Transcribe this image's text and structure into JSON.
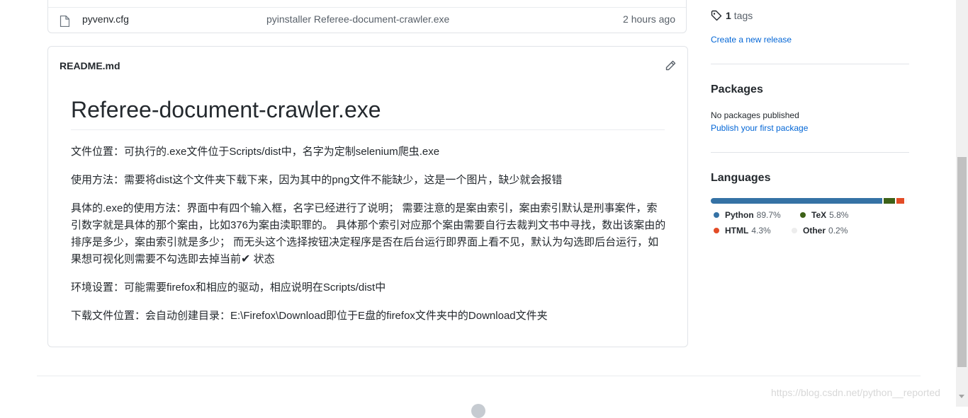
{
  "file_list": {
    "row": {
      "name": "pyvenv.cfg",
      "commit_message": "pyinstaller Referee-document-crawler.exe",
      "time": "2 hours ago"
    }
  },
  "readme": {
    "filename": "README.md",
    "heading": "Referee-document-crawler.exe",
    "paragraphs": [
      "文件位置：可执行的.exe文件位于Scripts/dist中，名字为定制selenium爬虫.exe",
      "使用方法：需要将dist这个文件夹下载下来，因为其中的png文件不能缺少，这是一个图片，缺少就会报错",
      "具体的.exe的使用方法：界面中有四个输入框，名字已经进行了说明； 需要注意的是案由索引，案由索引默认是刑事案件，索引数字就是具体的那个案由，比如376为案由渎职罪的。 具体那个索引对应那个案由需要自行去裁判文书中寻找，数出该案由的排序是多少，案由索引就是多少； 而无头这个选择按钮决定程序是否在后台运行即界面上看不见，默认为勾选即后台运行，如果想可视化则需要不勾选即去掉当前",
      "环境设置：可能需要firefox和相应的驱动，相应说明在Scripts/dist中",
      "下载文件位置：会自动创建目录：E:\\Firefox\\Download即位于E盘的firefox文件夹中的Download文件夹"
    ],
    "check_glyph": "✔",
    "check_suffix": " 状态"
  },
  "sidebar": {
    "tags": {
      "count": "1",
      "label": "tags"
    },
    "create_release": "Create a new release",
    "packages": {
      "title": "Packages",
      "none_text": "No packages published",
      "publish_link": "Publish your first package"
    },
    "languages": {
      "title": "Languages",
      "items": [
        {
          "name": "Python",
          "percent": "89.7%",
          "value": 89.7,
          "color": "#3572A5"
        },
        {
          "name": "TeX",
          "percent": "5.8%",
          "value": 5.8,
          "color": "#3D6117"
        },
        {
          "name": "HTML",
          "percent": "4.3%",
          "value": 4.3,
          "color": "#e34c26"
        },
        {
          "name": "Other",
          "percent": "0.2%",
          "value": 0.2,
          "color": "#ededed"
        }
      ]
    }
  },
  "watermark": "https://blog.csdn.net/python__reported"
}
